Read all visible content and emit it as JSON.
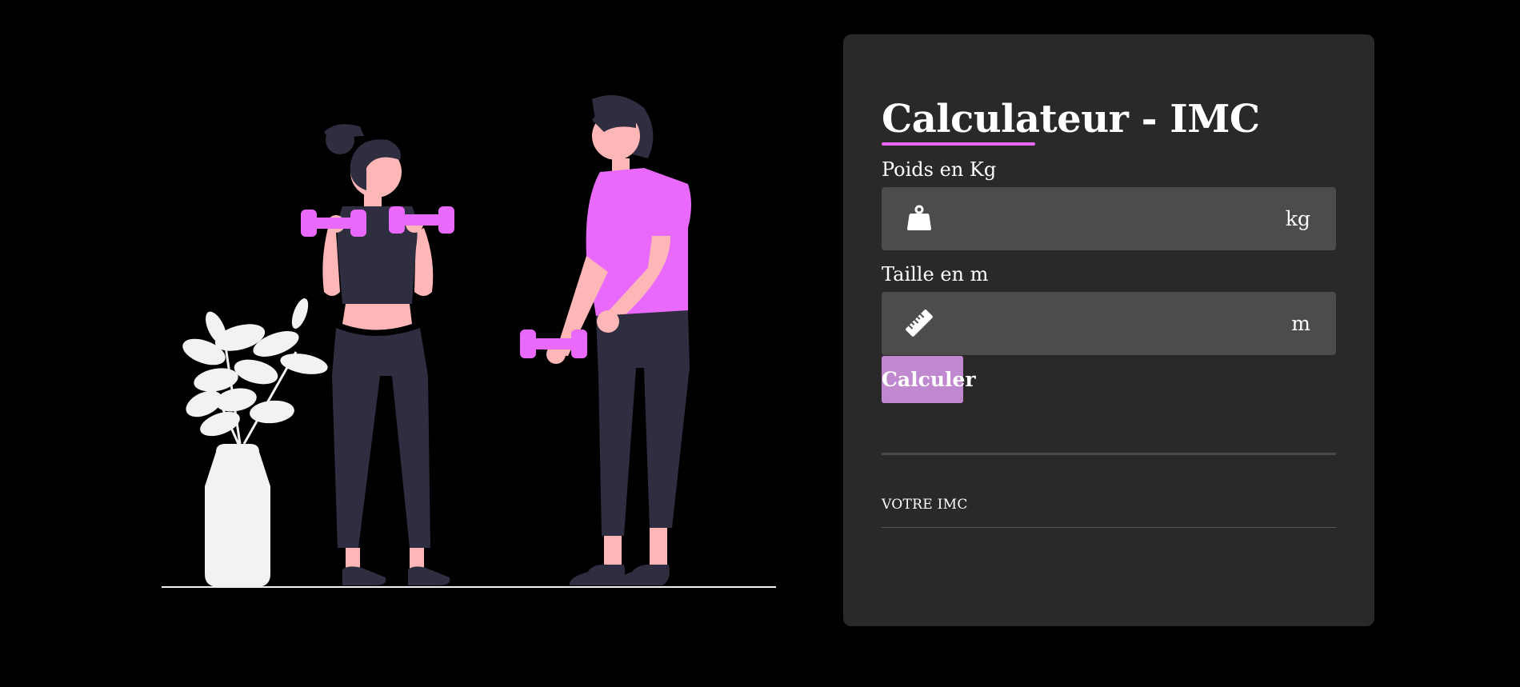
{
  "colors": {
    "background": "#000000",
    "card": "#2a2829",
    "input_bg": "#4e4b4b",
    "accent": "#e969fd",
    "button": "#c088cf",
    "text": "#ffffff",
    "figure_dark": "#2f2e41",
    "skin": "#ffb6b6",
    "plant": "#f2f2f2"
  },
  "calculator": {
    "title": "Calculateur - IMC",
    "weight": {
      "label": "Poids en Kg",
      "icon": "weight-icon",
      "value": "",
      "unit": "kg"
    },
    "height": {
      "label": "Taille en m",
      "icon": "ruler-icon",
      "value": "",
      "unit": "m"
    },
    "button_label": "Calculer",
    "result_label": "VOTRE IMC"
  }
}
